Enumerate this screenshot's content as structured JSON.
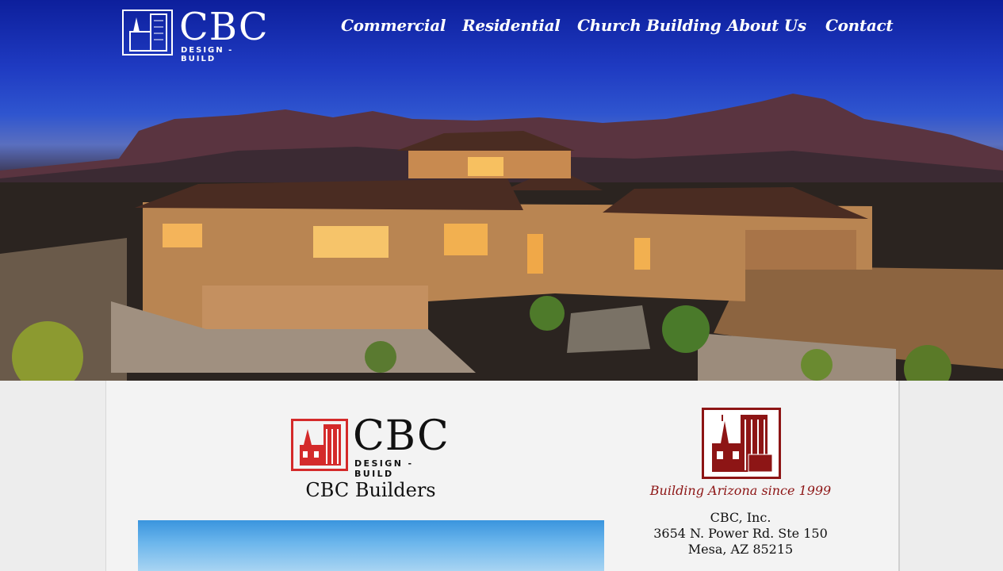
{
  "header": {
    "logo": {
      "wordmark": "CBC",
      "subtitle": "DESIGN - BUILD"
    },
    "nav": [
      {
        "label": "Commercial"
      },
      {
        "label": "Residential"
      },
      {
        "label": "Church Building"
      },
      {
        "label": "About Us"
      },
      {
        "label": "Contact"
      }
    ]
  },
  "content": {
    "logo": {
      "wordmark": "CBC",
      "subtitle": "DESIGN - BUILD"
    },
    "title": "CBC Builders",
    "sidebar": {
      "tagline": "Building Arizona since 1999",
      "address": [
        "CBC, Inc.",
        "3654 N. Power Rd. Ste 150",
        "Mesa, AZ 85215"
      ]
    }
  },
  "colors": {
    "sky": "#1f3bc2",
    "logo_red": "#d42a2a",
    "tagline_red": "#8d1515",
    "panel_bg": "#f3f3f3"
  }
}
